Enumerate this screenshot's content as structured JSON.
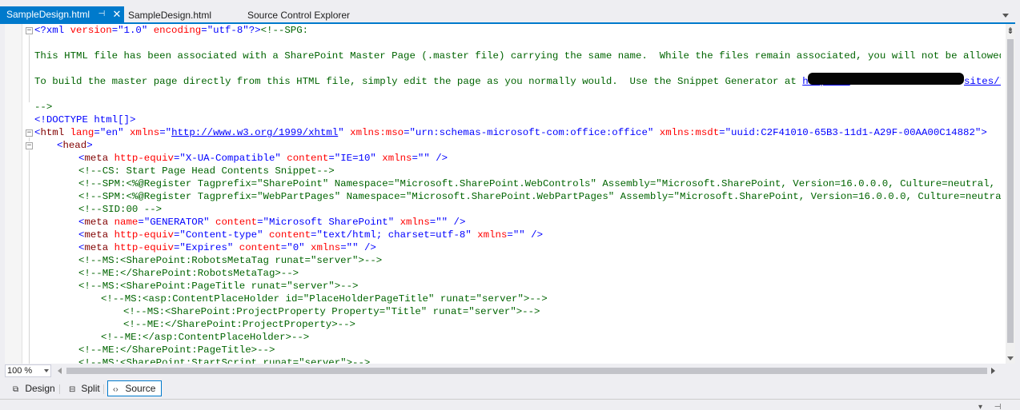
{
  "tabs": [
    {
      "label": "SampleDesign.html",
      "active": true,
      "pin_icon": "pin-icon",
      "close_icon": "close-icon"
    },
    {
      "label": "SampleDesign.html",
      "active": false
    },
    {
      "label": "Source Control Explorer",
      "active": false
    }
  ],
  "colors": {
    "accent": "#007acc",
    "tag": "#800000",
    "attribute": "#ff0000",
    "value": "#0000ff",
    "comment": "#006400"
  },
  "code": {
    "line1_pi_open": "<?xml ",
    "line1_attr1": "version",
    "line1_val1": "\"1.0\"",
    "line1_attr2": "encoding",
    "line1_val2": "\"utf-8\"",
    "line1_pi_close": "?>",
    "line1_comment": "<!--SPG:",
    "line3_text": "This HTML file has been associated with a SharePoint Master Page (.master file) carrying the same name.  While the files remain associated, you will not be allowed to edit t",
    "line5_text": "To build the master page directly from this HTML file, simply edit the page as you normally would.  Use the Snippet Generator at ",
    "line5_link": "https://",
    "line5_link_tail": "sites/I",
    "line7_text": "-->",
    "doctype": "<!DOCTYPE html[]>",
    "html_open": "<",
    "html_tag": "html",
    "html_lang_attr": "lang",
    "html_lang_val": "\"en\"",
    "html_xmlns_attr": "xmlns",
    "html_xmlns_val": "\"http://www.w3.org/1999/xhtml\"",
    "html_xmlns_val_link": "http://www.w3.org/1999/xhtml",
    "html_mso_attr": "xmlns:mso",
    "html_mso_val": "\"urn:schemas-microsoft-com:office:office\"",
    "html_msdt_attr": "xmlns:msdt",
    "html_msdt_val": "\"uuid:C2F41010-65B3-11d1-A29F-00AA00C14882\"",
    "html_close": ">",
    "head_open": "<",
    "head_tag": "head",
    "head_close": ">",
    "meta1": {
      "tag": "meta",
      "a1": "http-equiv",
      "v1": "\"X-UA-Compatible\"",
      "a2": "content",
      "v2": "\"IE=10\"",
      "a3": "xmlns",
      "v3": "\"\"",
      "end": " />"
    },
    "cs_comment": "<!--CS: Start Page Head Contents Snippet-->",
    "spm1": "<!--SPM:<%@Register Tagprefix=\"SharePoint\" Namespace=\"Microsoft.SharePoint.WebControls\" Assembly=\"Microsoft.SharePoint, Version=16.0.0.0, Culture=neutral, PublicKeyT",
    "spm2": "<!--SPM:<%@Register Tagprefix=\"WebPartPages\" Namespace=\"Microsoft.SharePoint.WebPartPages\" Assembly=\"Microsoft.SharePoint, Version=16.0.0.0, Culture=neutral, PublicK",
    "sid": "<!--SID:00 -->",
    "meta2": {
      "tag": "meta",
      "a1": "name",
      "v1": "\"GENERATOR\"",
      "a2": "content",
      "v2": "\"Microsoft SharePoint\"",
      "a3": "xmlns",
      "v3": "\"\"",
      "end": " />"
    },
    "meta3": {
      "tag": "meta",
      "a1": "http-equiv",
      "v1": "\"Content-type\"",
      "a2": "content",
      "v2": "\"text/html; charset=utf-8\"",
      "a3": "xmlns",
      "v3": "\"\"",
      "end": " />"
    },
    "meta4": {
      "tag": "meta",
      "a1": "http-equiv",
      "v1": "\"Expires\"",
      "a2": "content",
      "v2": "\"0\"",
      "a3": "xmlns",
      "v3": "\"\"",
      "end": " />"
    },
    "ms1": "<!--MS:<SharePoint:RobotsMetaTag runat=\"server\">-->",
    "me1": "<!--ME:</SharePoint:RobotsMetaTag>-->",
    "ms2": "<!--MS:<SharePoint:PageTitle runat=\"server\">-->",
    "ms3": "<!--MS:<asp:ContentPlaceHolder id=\"PlaceHolderPageTitle\" runat=\"server\">-->",
    "ms4": "<!--MS:<SharePoint:ProjectProperty Property=\"Title\" runat=\"server\">-->",
    "me2": "<!--ME:</SharePoint:ProjectProperty>-->",
    "me3": "<!--ME:</asp:ContentPlaceHolder>-->",
    "me4": "<!--ME:</SharePoint:PageTitle>-->",
    "ms5": "<!--MS:<SharePoint:StartScript runat=\"server\">-->"
  },
  "zoom": {
    "value": "100 %"
  },
  "views": [
    {
      "label": "Design",
      "icon": "design-view-icon"
    },
    {
      "label": "Split",
      "icon": "split-view-icon"
    },
    {
      "label": "Source",
      "icon": "source-view-icon",
      "selected": true
    }
  ]
}
